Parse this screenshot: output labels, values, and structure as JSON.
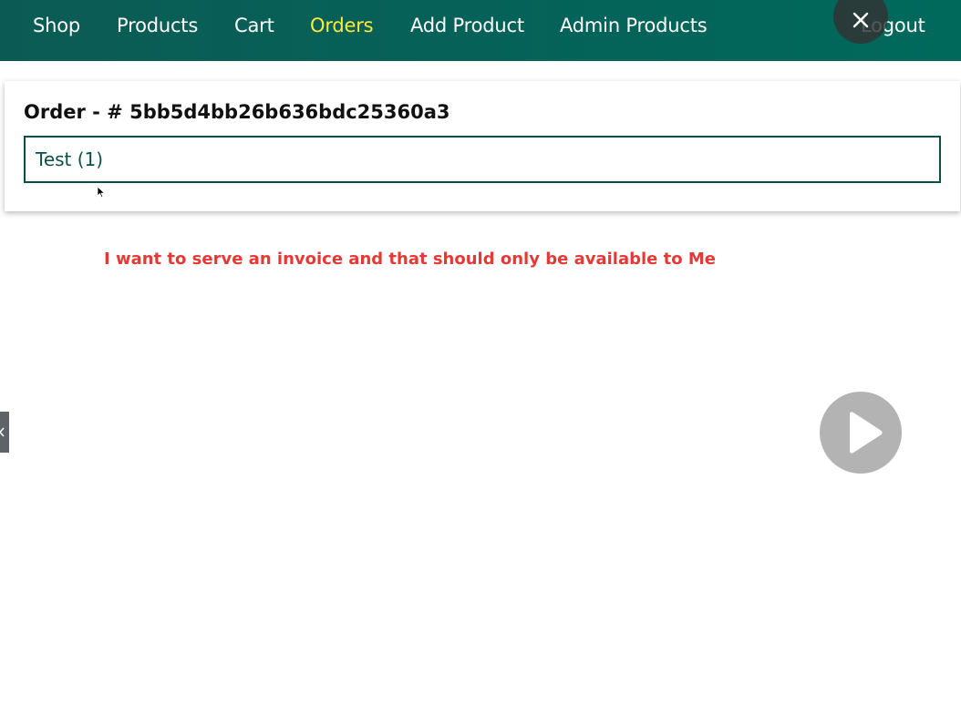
{
  "nav": {
    "items": [
      {
        "label": "Shop",
        "active": false
      },
      {
        "label": "Products",
        "active": false
      },
      {
        "label": "Cart",
        "active": false
      },
      {
        "label": "Orders",
        "active": true
      },
      {
        "label": "Add Product",
        "active": false
      },
      {
        "label": "Admin Products",
        "active": false
      }
    ],
    "logout_label": "Logout",
    "active_color": "#ffeb3b",
    "background_color": "#00695c"
  },
  "overlay": {
    "close_icon": "close-icon",
    "play_icon": "play-icon"
  },
  "order": {
    "title": "Order - # 5bb5d4bb26b636bdc25360a3",
    "items": [
      {
        "text": "Test (1)"
      }
    ]
  },
  "annotation": {
    "text": "I want to serve an invoice and that should only be available to Me",
    "color": "#e53935"
  }
}
